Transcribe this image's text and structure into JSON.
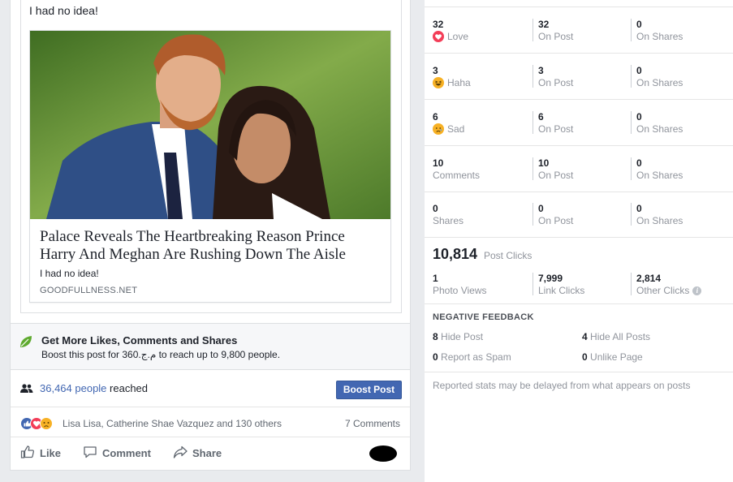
{
  "post": {
    "text": "I had no idea!",
    "link": {
      "title": "Palace Reveals The Heartbreaking Reason Prince Harry And Meghan Are Rushing Down The Aisle",
      "description": "I had no idea!",
      "domain": "GOODFULLNESS.NET"
    },
    "boost": {
      "title": "Get More Likes, Comments and Shares",
      "subtitle": "Boost this post for 360.م.ج to reach up to 9,800 people."
    },
    "reach": {
      "count": "36,464 people",
      "suffix": " reached",
      "button": "Boost Post"
    },
    "reactions": {
      "names": "Lisa Lisa, Catherine Shae Vazquez and 130 others",
      "comments": "7 Comments"
    },
    "actions": {
      "like": "Like",
      "comment": "Comment",
      "share": "Share"
    }
  },
  "insights": {
    "rows": [
      {
        "total": "32",
        "label": "Love",
        "icon": "love-icon",
        "on_post": "32",
        "on_post_label": "On Post",
        "on_shares": "0",
        "on_shares_label": "On Shares"
      },
      {
        "total": "3",
        "label": "Haha",
        "icon": "haha-icon",
        "on_post": "3",
        "on_post_label": "On Post",
        "on_shares": "0",
        "on_shares_label": "On Shares"
      },
      {
        "total": "6",
        "label": "Sad",
        "icon": "sad-icon",
        "on_post": "6",
        "on_post_label": "On Post",
        "on_shares": "0",
        "on_shares_label": "On Shares"
      },
      {
        "total": "10",
        "label": "Comments",
        "icon": "",
        "on_post": "10",
        "on_post_label": "On Post",
        "on_shares": "0",
        "on_shares_label": "On Shares"
      },
      {
        "total": "0",
        "label": "Shares",
        "icon": "",
        "on_post": "0",
        "on_post_label": "On Post",
        "on_shares": "0",
        "on_shares_label": "On Shares"
      }
    ],
    "post_clicks": {
      "value": "10,814",
      "label": "Post Clicks"
    },
    "click_breakdown": [
      {
        "value": "1",
        "label": "Photo Views"
      },
      {
        "value": "7,999",
        "label": "Link Clicks"
      },
      {
        "value": "2,814",
        "label": "Other Clicks"
      }
    ],
    "negative_feedback": {
      "title": "NEGATIVE FEEDBACK",
      "hide_post": {
        "value": "8",
        "label": " Hide Post"
      },
      "hide_all": {
        "value": "4",
        "label": " Hide All Posts"
      },
      "report_spam": {
        "value": "0",
        "label": " Report as Spam"
      },
      "unlike_page": {
        "value": "0",
        "label": " Unlike Page"
      }
    },
    "note": "Reported stats may be delayed from what appears on posts"
  },
  "colors": {
    "brand_blue": "#4267b2",
    "love_red": "#f33e58",
    "emoji_yellow": "#f7b125",
    "leaf_green": "#5eaa2f"
  }
}
